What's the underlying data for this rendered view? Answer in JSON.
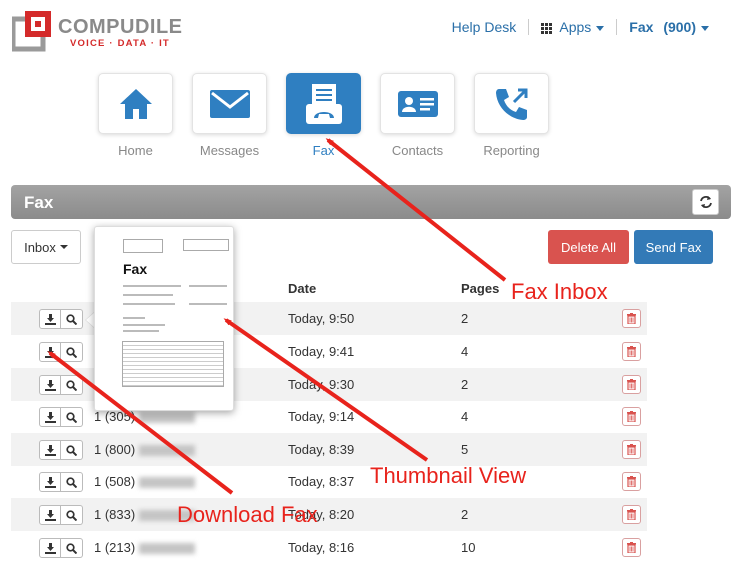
{
  "brand": {
    "name": "COMPUDILE",
    "tagline": "VOICE · DATA · IT"
  },
  "topnav": {
    "help": "Help Desk",
    "apps": "Apps",
    "fax": "Fax",
    "fax_count": "(900)"
  },
  "tiles": [
    {
      "label": "Home",
      "icon": "home-icon"
    },
    {
      "label": "Messages",
      "icon": "envelope-icon"
    },
    {
      "label": "Fax",
      "icon": "fax-icon"
    },
    {
      "label": "Contacts",
      "icon": "contact-card-icon"
    },
    {
      "label": "Reporting",
      "icon": "phone-forward-icon"
    }
  ],
  "panel": {
    "title": "Fax"
  },
  "toolbar": {
    "inbox": "Inbox",
    "delete_all": "Delete All",
    "send_fax": "Send Fax"
  },
  "table": {
    "headers": {
      "date": "Date",
      "pages": "Pages"
    },
    "rows": [
      {
        "number": "",
        "date": "Today, 9:50",
        "pages": "2"
      },
      {
        "number": "",
        "date": "Today, 9:41",
        "pages": "4"
      },
      {
        "number": "",
        "date": "Today, 9:30",
        "pages": "2"
      },
      {
        "number": "1 (305)",
        "date": "Today, 9:14",
        "pages": "4"
      },
      {
        "number": "1 (800)",
        "date": "Today, 8:39",
        "pages": "5"
      },
      {
        "number": "1 (508)",
        "date": "Today, 8:37",
        "pages": ""
      },
      {
        "number": "1 (833)",
        "date": "Today, 8:20",
        "pages": "2"
      },
      {
        "number": "1 (213)",
        "date": "Today, 8:16",
        "pages": "10"
      }
    ]
  },
  "thumbnail": {
    "title": "Fax"
  },
  "annotations": {
    "fax_inbox": "Fax Inbox",
    "thumbnail_view": "Thumbnail View",
    "download_fax": "Download Fax"
  },
  "colors": {
    "accent": "#2f7fc1",
    "danger": "#d9534f",
    "primary": "#337ab7",
    "annotation": "#e8231c"
  }
}
